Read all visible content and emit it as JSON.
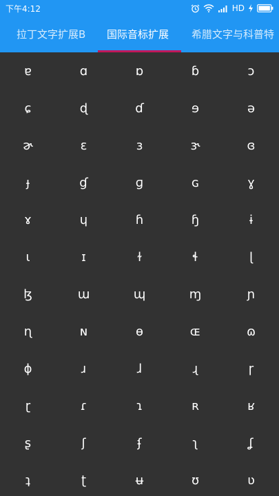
{
  "status_bar": {
    "time": "下午4:12",
    "network": "HD"
  },
  "tabs": [
    {
      "label": "拉丁文字扩展B"
    },
    {
      "label": "国际音标扩展"
    },
    {
      "label": "希腊文字与科普特"
    }
  ],
  "active_tab": 1,
  "symbols": [
    [
      "ɐ",
      "ɑ",
      "ɒ",
      "ɓ",
      "ɔ"
    ],
    [
      "ɕ",
      "ɖ",
      "ɗ",
      "ɘ",
      "ə"
    ],
    [
      "ɚ",
      "ɛ",
      "ɜ",
      "ɝ",
      "ɞ"
    ],
    [
      "ɟ",
      "ɠ",
      "ɡ",
      "ɢ",
      "ɣ"
    ],
    [
      "ɤ",
      "ɥ",
      "ɦ",
      "ɧ",
      "ɨ"
    ],
    [
      "ɩ",
      "ɪ",
      "ɫ",
      "ɬ",
      "ɭ"
    ],
    [
      "ɮ",
      "ɯ",
      "ɰ",
      "ɱ",
      "ɲ"
    ],
    [
      "ɳ",
      "ɴ",
      "ɵ",
      "ɶ",
      "ɷ"
    ],
    [
      "ɸ",
      "ɹ",
      "ɺ",
      "ɻ",
      "ɼ"
    ],
    [
      "ɽ",
      "ɾ",
      "ɿ",
      "ʀ",
      "ʁ"
    ],
    [
      "ʂ",
      "ʃ",
      "ʄ",
      "ʅ",
      "ʆ"
    ],
    [
      "ʇ",
      "ʈ",
      "ʉ",
      "ʊ",
      "ʋ"
    ]
  ]
}
